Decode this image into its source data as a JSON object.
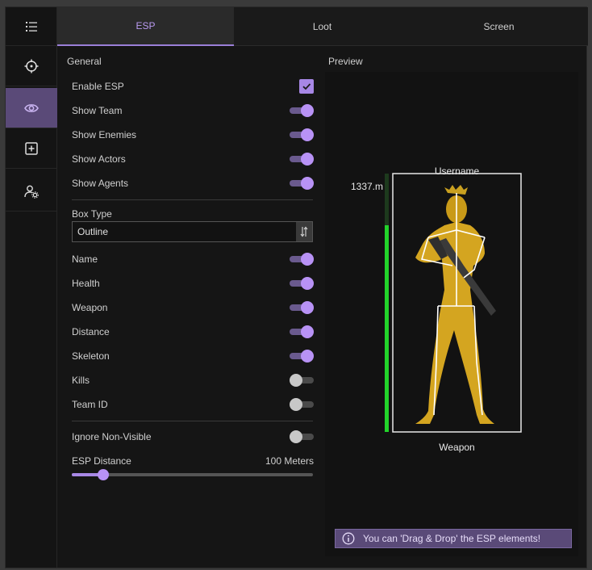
{
  "tabs": [
    {
      "label": "ESP",
      "active": true
    },
    {
      "label": "Loot",
      "active": false
    },
    {
      "label": "Screen",
      "active": false
    }
  ],
  "sidebar": {
    "items": [
      {
        "icon": "list-icon",
        "active": false
      },
      {
        "icon": "crosshair-icon",
        "active": false
      },
      {
        "icon": "eye-icon",
        "active": true
      },
      {
        "icon": "plus-box-icon",
        "active": false
      },
      {
        "icon": "user-gear-icon",
        "active": false
      }
    ]
  },
  "general": {
    "title": "General",
    "enable_esp": {
      "label": "Enable ESP",
      "checked": true
    },
    "toggles_top": [
      {
        "label": "Show Team",
        "on": true
      },
      {
        "label": "Show Enemies",
        "on": true
      },
      {
        "label": "Show Actors",
        "on": true
      },
      {
        "label": "Show Agents",
        "on": true
      }
    ],
    "box_type": {
      "label": "Box Type",
      "value": "Outline"
    },
    "toggles_mid": [
      {
        "label": "Name",
        "on": true
      },
      {
        "label": "Health",
        "on": true
      },
      {
        "label": "Weapon",
        "on": true
      },
      {
        "label": "Distance",
        "on": true
      },
      {
        "label": "Skeleton",
        "on": true
      },
      {
        "label": "Kills",
        "on": false
      },
      {
        "label": "Team ID",
        "on": false
      }
    ],
    "ignore_non_visible": {
      "label": "Ignore Non-Visible",
      "on": false
    },
    "esp_distance": {
      "label": "ESP Distance",
      "value_text": "100 Meters",
      "fraction": 0.13
    }
  },
  "preview": {
    "title": "Preview",
    "username": "Username",
    "distance": "1337.m",
    "weapon": "Weapon",
    "health_fraction": 0.8,
    "info": "You can 'Drag & Drop' the ESP elements!"
  },
  "colors": {
    "accent": "#b892f5",
    "health": "#22d42a"
  }
}
